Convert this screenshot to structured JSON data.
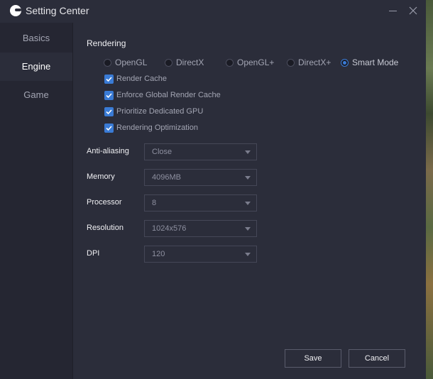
{
  "window": {
    "title": "Setting Center"
  },
  "sidebar": {
    "items": [
      {
        "label": "Basics"
      },
      {
        "label": "Engine"
      },
      {
        "label": "Game"
      }
    ],
    "active": "Engine"
  },
  "rendering": {
    "section_title": "Rendering",
    "modes": [
      {
        "label": "OpenGL",
        "checked": false
      },
      {
        "label": "DirectX",
        "checked": false
      },
      {
        "label": "OpenGL+",
        "checked": false
      },
      {
        "label": "DirectX+",
        "checked": false
      },
      {
        "label": "Smart Mode",
        "checked": true
      }
    ],
    "options": [
      {
        "label": "Render Cache",
        "checked": true
      },
      {
        "label": "Enforce Global Render Cache",
        "checked": true
      },
      {
        "label": "Prioritize Dedicated GPU",
        "checked": true
      },
      {
        "label": "Rendering Optimization",
        "checked": true
      }
    ]
  },
  "fields": [
    {
      "label": "Anti-aliasing",
      "value": "Close"
    },
    {
      "label": "Memory",
      "value": "4096MB"
    },
    {
      "label": "Processor",
      "value": "8"
    },
    {
      "label": "Resolution",
      "value": "1024x576"
    },
    {
      "label": "DPI",
      "value": "120"
    }
  ],
  "buttons": {
    "save": "Save",
    "cancel": "Cancel"
  },
  "colors": {
    "accent": "#3a7bd5",
    "background": "#2b2d3a",
    "sidebar": "#252632"
  },
  "icons": {
    "app": "app-logo-icon",
    "minimize": "minimize-icon",
    "close": "close-icon",
    "check": "checkmark-icon",
    "dropdown": "chevron-down-icon"
  }
}
